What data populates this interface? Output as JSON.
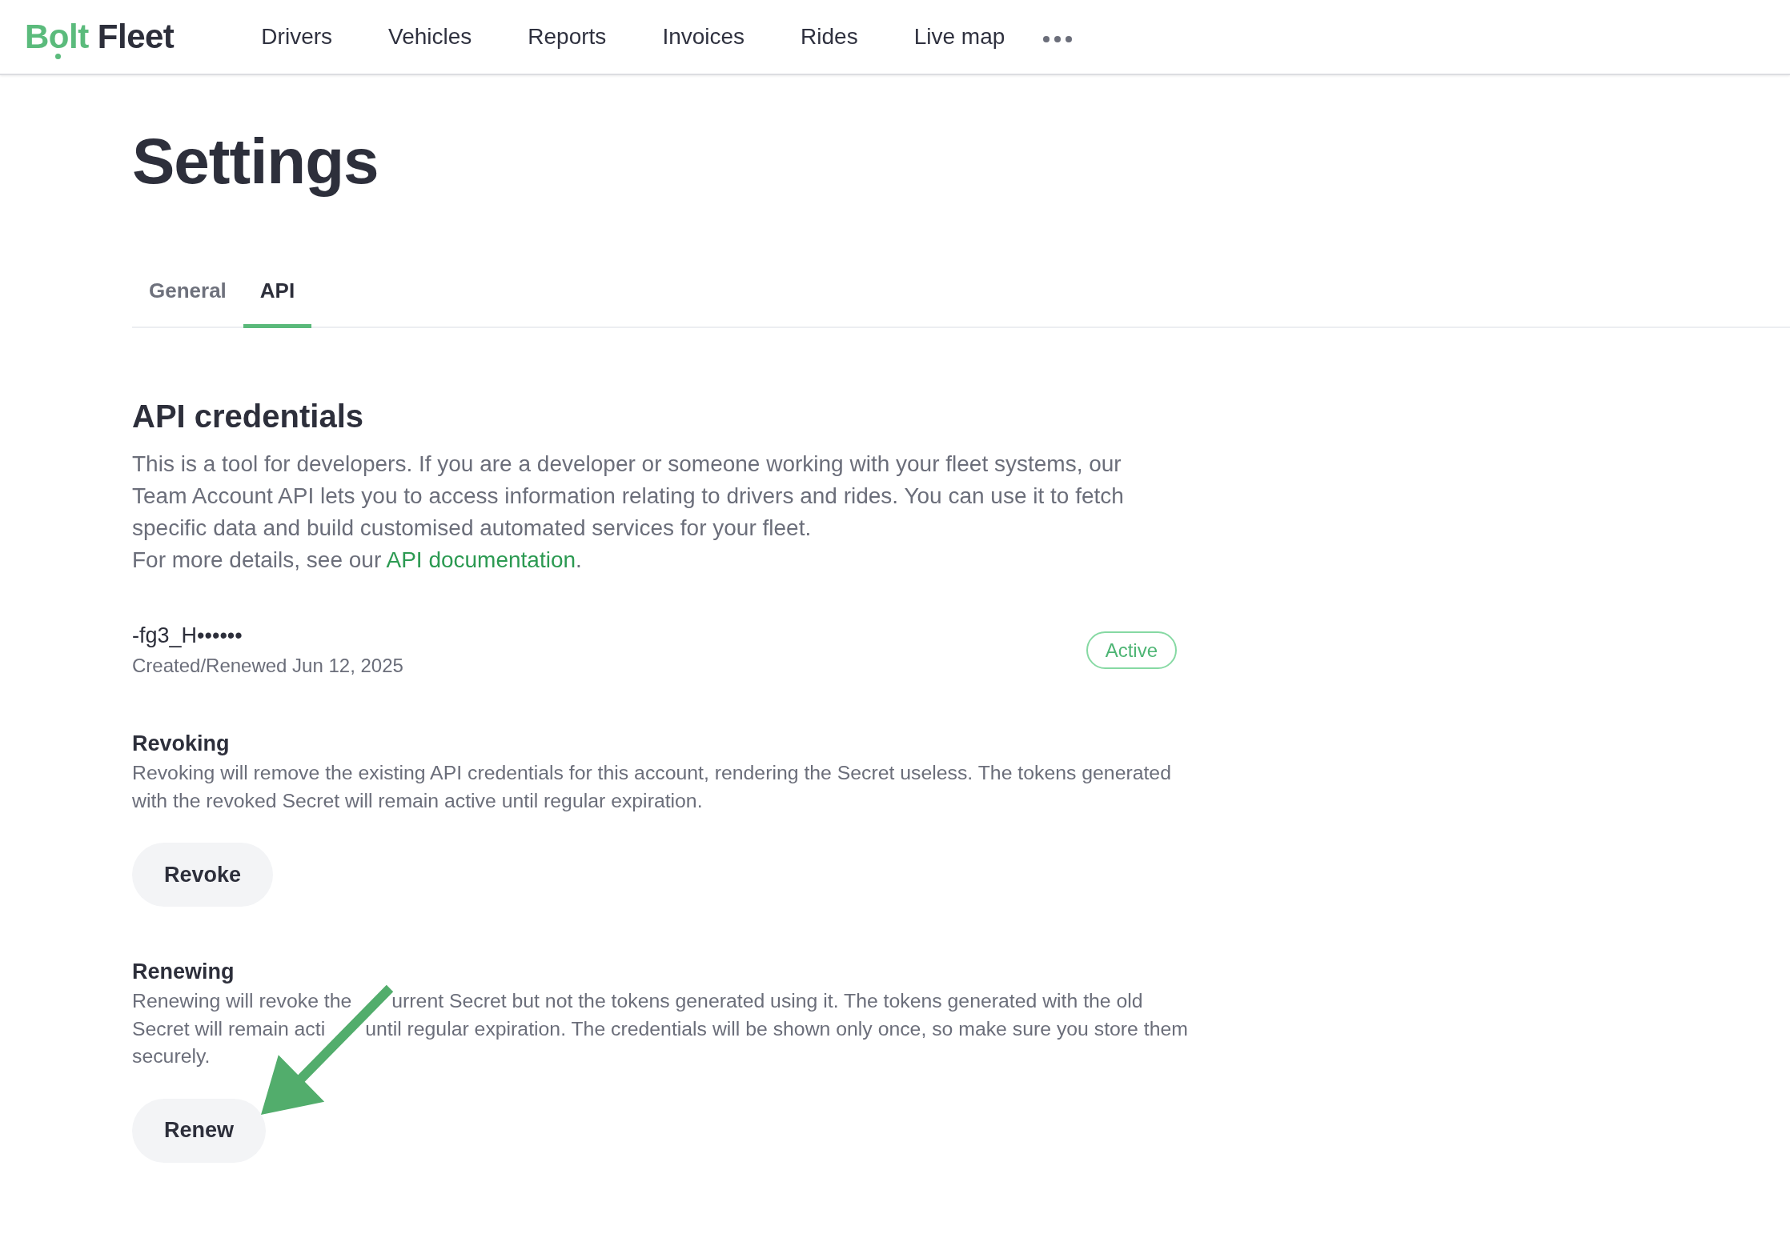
{
  "header": {
    "logo": {
      "brand": "Bolt",
      "product": "Fleet"
    },
    "nav": [
      {
        "label": "Drivers"
      },
      {
        "label": "Vehicles"
      },
      {
        "label": "Reports"
      },
      {
        "label": "Invoices"
      },
      {
        "label": "Rides"
      },
      {
        "label": "Live map"
      }
    ]
  },
  "page": {
    "title": "Settings"
  },
  "tabs": [
    {
      "label": "General",
      "selected": false
    },
    {
      "label": "API",
      "selected": true
    }
  ],
  "api_credentials": {
    "title": "API credentials",
    "description": "This is a tool for developers. If you are a developer or someone working with your fleet systems, our Team Account API lets you to access information relating to drivers and rides. You can use it to fetch specific data and build customised automated services for your fleet.",
    "details": {
      "lead": "For more details, see our",
      "link": "API documentation",
      "trail": "."
    },
    "credential": {
      "key": "-fg3_H••••••",
      "created": "Created/Renewed Jun 12, 2025",
      "status": "Active"
    },
    "actions": [
      {
        "title": "Revoking",
        "description": "Revoking will remove the existing API credentials for this account, rendering the Secret useless. The tokens generated with the revoked Secret will remain active until regular expiration.",
        "button": "Revoke"
      },
      {
        "title": "Renewing",
        "description_lines": [
          [
            "Renewing will revoke the",
            "urrent Secret but not the tokens generated using it. The tokens generated with the old"
          ],
          [
            "Secret will remain acti",
            "until regular expiration. The credentials will be shown only once, so make sure you store them"
          ],
          [
            "securely."
          ]
        ],
        "button": "Renew"
      }
    ]
  }
}
